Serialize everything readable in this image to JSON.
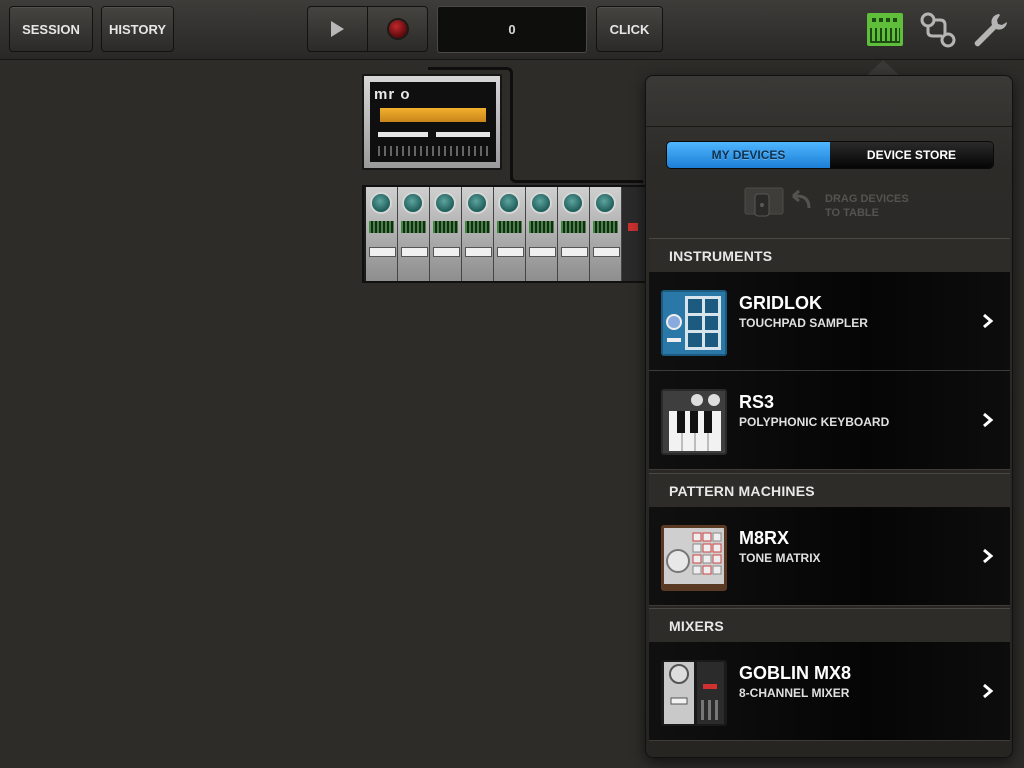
{
  "toolbar": {
    "session_label": "SESSION",
    "history_label": "HISTORY",
    "counter_value": "0",
    "click_label": "CLICK"
  },
  "canvas": {
    "synth_logo": "mr o"
  },
  "device_panel": {
    "tabs": [
      {
        "label": "MY DEVICES",
        "active": true
      },
      {
        "label": "DEVICE STORE",
        "active": false
      }
    ],
    "drag_hint": "DRAG DEVICES\nTO TABLE",
    "sections": [
      {
        "title": "INSTRUMENTS",
        "items": [
          {
            "name": "GRIDLOK",
            "subtitle": "TOUCHPAD SAMPLER"
          },
          {
            "name": "RS3",
            "subtitle": "POLYPHONIC KEYBOARD"
          }
        ]
      },
      {
        "title": "PATTERN MACHINES",
        "items": [
          {
            "name": "M8RX",
            "subtitle": "TONE MATRIX"
          }
        ]
      },
      {
        "title": "MIXERS",
        "items": [
          {
            "name": "GOBLIN MX8",
            "subtitle": "8-CHANNEL MIXER"
          }
        ]
      }
    ]
  },
  "colors": {
    "accent_blue": "#2a8ff0",
    "devices_icon_green": "#5fbf3a"
  }
}
